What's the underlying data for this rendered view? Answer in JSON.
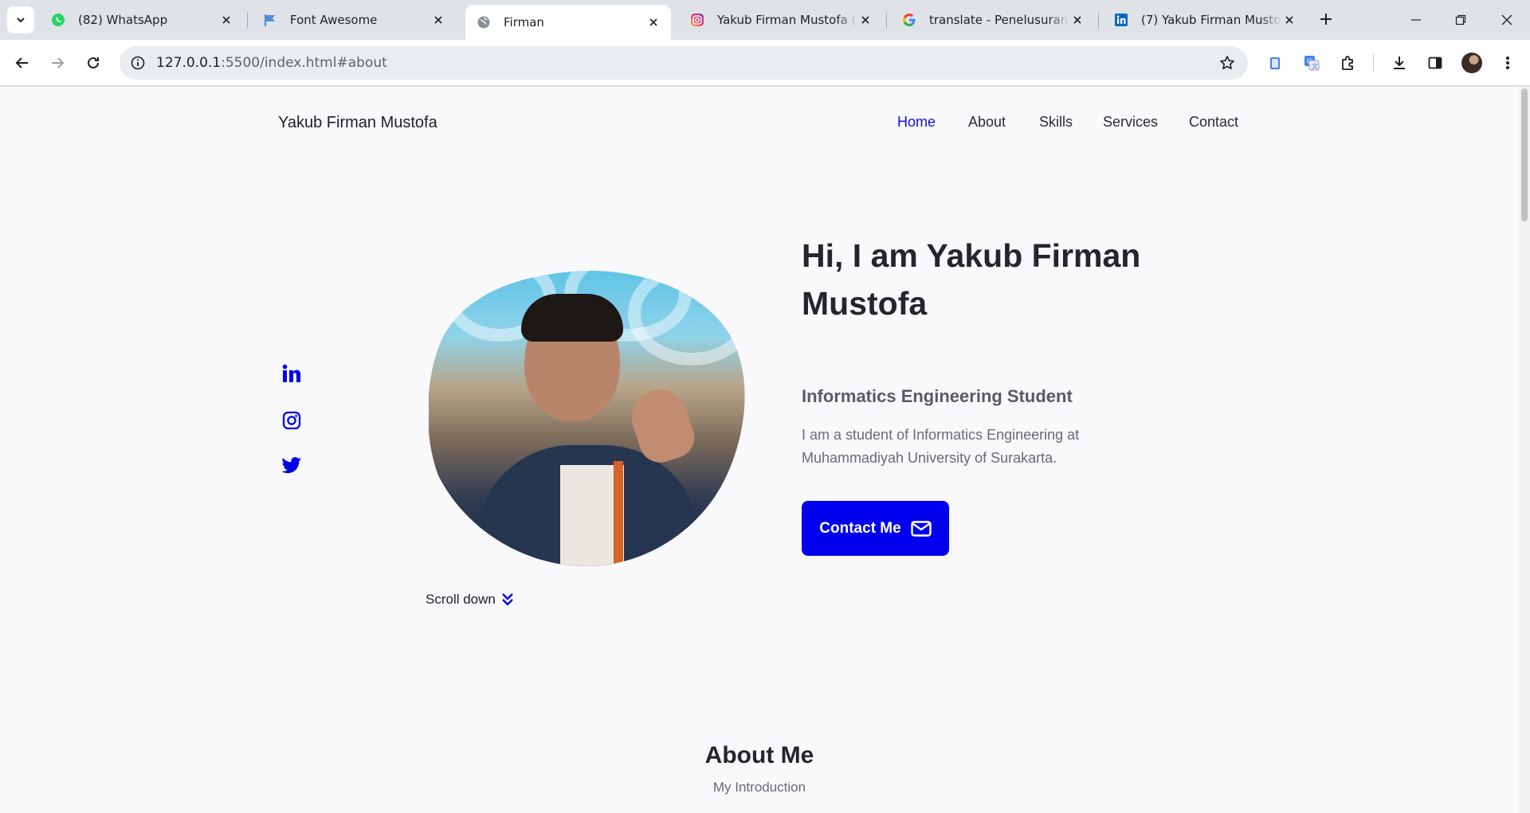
{
  "browser": {
    "tabs": [
      {
        "title": "(82) WhatsApp",
        "icon": "whatsapp-icon",
        "active": false
      },
      {
        "title": "Font Awesome",
        "icon": "font-awesome-flag-icon",
        "active": false
      },
      {
        "title": "Firman",
        "icon": "globe-icon",
        "active": true
      },
      {
        "title": "Yakub Firman Mustofa (@f",
        "icon": "instagram-icon",
        "active": false
      },
      {
        "title": "translate - Penelusuran Go",
        "icon": "google-icon",
        "active": false
      },
      {
        "title": "(7) Yakub Firman Mustofa |",
        "icon": "linkedin-icon",
        "active": false
      }
    ],
    "url_host": "127.0.0.1",
    "url_rest": ":5500/index.html#about",
    "colors": {
      "accent": "#0000ee",
      "tabstrip": "#dfe3e8"
    }
  },
  "site": {
    "brand": "Yakub Firman Mustofa",
    "nav": [
      {
        "label": "Home",
        "active": true
      },
      {
        "label": "About",
        "active": false
      },
      {
        "label": "Skills",
        "active": false
      },
      {
        "label": "Services",
        "active": false
      },
      {
        "label": "Contact",
        "active": false
      }
    ],
    "social": [
      "linkedin-icon",
      "instagram-icon",
      "twitter-icon"
    ],
    "hero": {
      "title": "Hi, I am Yakub Firman Mustofa",
      "subtitle": "Informatics Engineering Student",
      "description": "I am a student of Informatics Engineering at Muhammadiyah University of Surakarta.",
      "cta": "Contact Me"
    },
    "scroll_down": "Scroll down",
    "about": {
      "title": "About Me",
      "subtitle": "My Introduction"
    }
  }
}
